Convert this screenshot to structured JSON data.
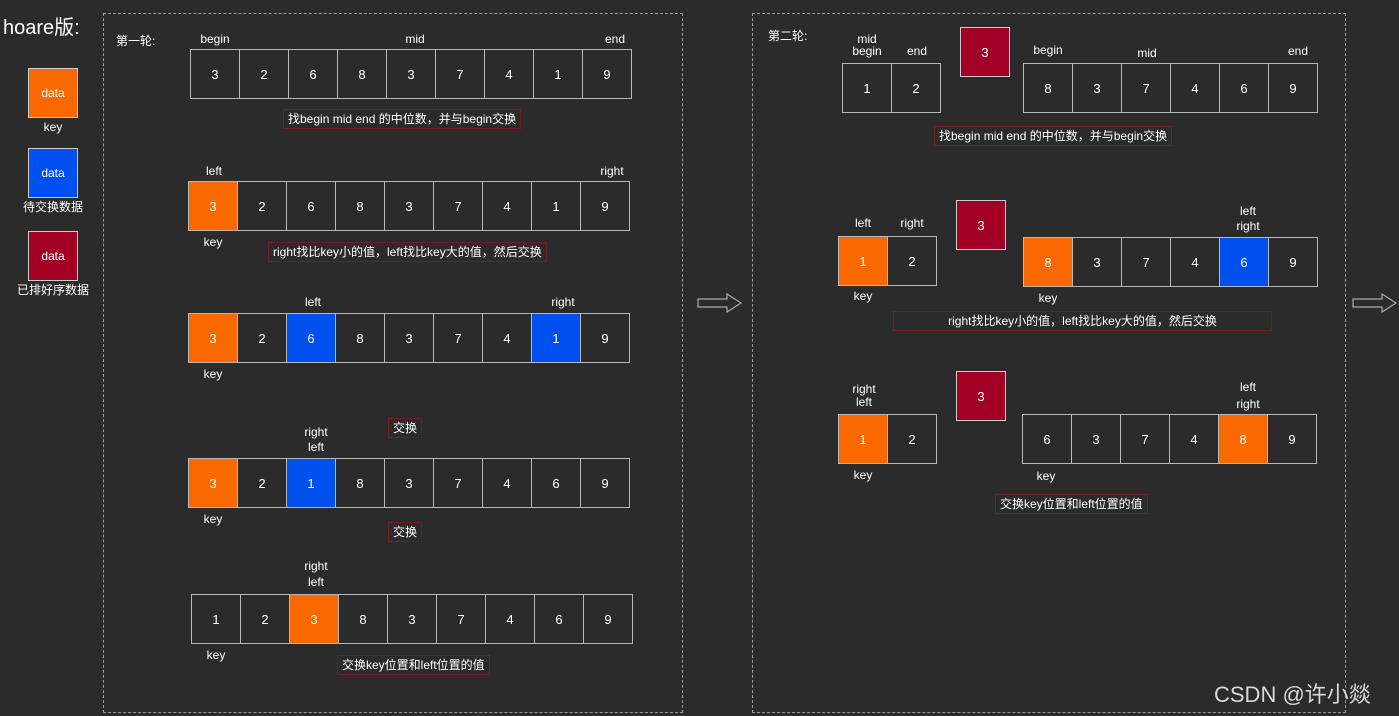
{
  "title": "hoare版:",
  "legend": [
    {
      "cell": "data",
      "label": "key",
      "color": "#fa6800"
    },
    {
      "cell": "data",
      "label": "待交换数据",
      "color": "#0050ef"
    },
    {
      "cell": "data",
      "label": "已排好序数据",
      "color": "#a20025"
    }
  ],
  "round1": {
    "heading": "第一轮:",
    "s1": {
      "begin": "begin",
      "mid": "mid",
      "end": "end",
      "values": [
        "3",
        "2",
        "6",
        "8",
        "3",
        "7",
        "4",
        "1",
        "9"
      ],
      "note": "找begin mid end 的中位数，并与begin交换"
    },
    "s2": {
      "left": "left",
      "right": "right",
      "key": "key",
      "values": [
        "3",
        "2",
        "6",
        "8",
        "3",
        "7",
        "4",
        "1",
        "9"
      ],
      "note": "right找比key小的值，left找比key大的值，然后交换"
    },
    "s3": {
      "left": "left",
      "right": "right",
      "key": "key",
      "values": [
        "3",
        "2",
        "6",
        "8",
        "3",
        "7",
        "4",
        "1",
        "9"
      ]
    },
    "s4": {
      "swap_note": "交换",
      "right": "right",
      "left": "left",
      "key": "key",
      "values": [
        "3",
        "2",
        "1",
        "8",
        "3",
        "7",
        "4",
        "6",
        "9"
      ],
      "swap_note2": "交换"
    },
    "s5": {
      "right": "right",
      "left": "left",
      "key": "key",
      "values": [
        "1",
        "2",
        "3",
        "8",
        "3",
        "7",
        "4",
        "6",
        "9"
      ],
      "note": "交换key位置和left位置的值"
    }
  },
  "round2": {
    "heading": "第二轮:",
    "s1": {
      "mid": "mid",
      "begin": "begin",
      "end": "end",
      "left_values": [
        "1",
        "2"
      ],
      "sorted": "3",
      "begin2": "begin",
      "mid2": "mid",
      "end2": "end",
      "right_values": [
        "8",
        "3",
        "7",
        "4",
        "6",
        "9"
      ],
      "note": "找begin mid end 的中位数，并与begin交换"
    },
    "s2": {
      "left": "left",
      "right": "right",
      "key": "key",
      "left_values": [
        "1",
        "2"
      ],
      "sorted": "3",
      "left2": "left",
      "right2": "right",
      "key2": "key",
      "right_values": [
        "8",
        "3",
        "7",
        "4",
        "6",
        "9"
      ],
      "note": "right找比key小的值，left找比key大的值，然后交换"
    },
    "s3": {
      "right": "right",
      "left": "left",
      "key": "key",
      "left_values": [
        "1",
        "2"
      ],
      "sorted": "3",
      "left2": "left",
      "right2": "right",
      "key2": "key",
      "right_values": [
        "6",
        "3",
        "7",
        "4",
        "8",
        "9"
      ],
      "note": "交换key位置和left位置的值"
    }
  },
  "watermark": "CSDN @许小燚"
}
